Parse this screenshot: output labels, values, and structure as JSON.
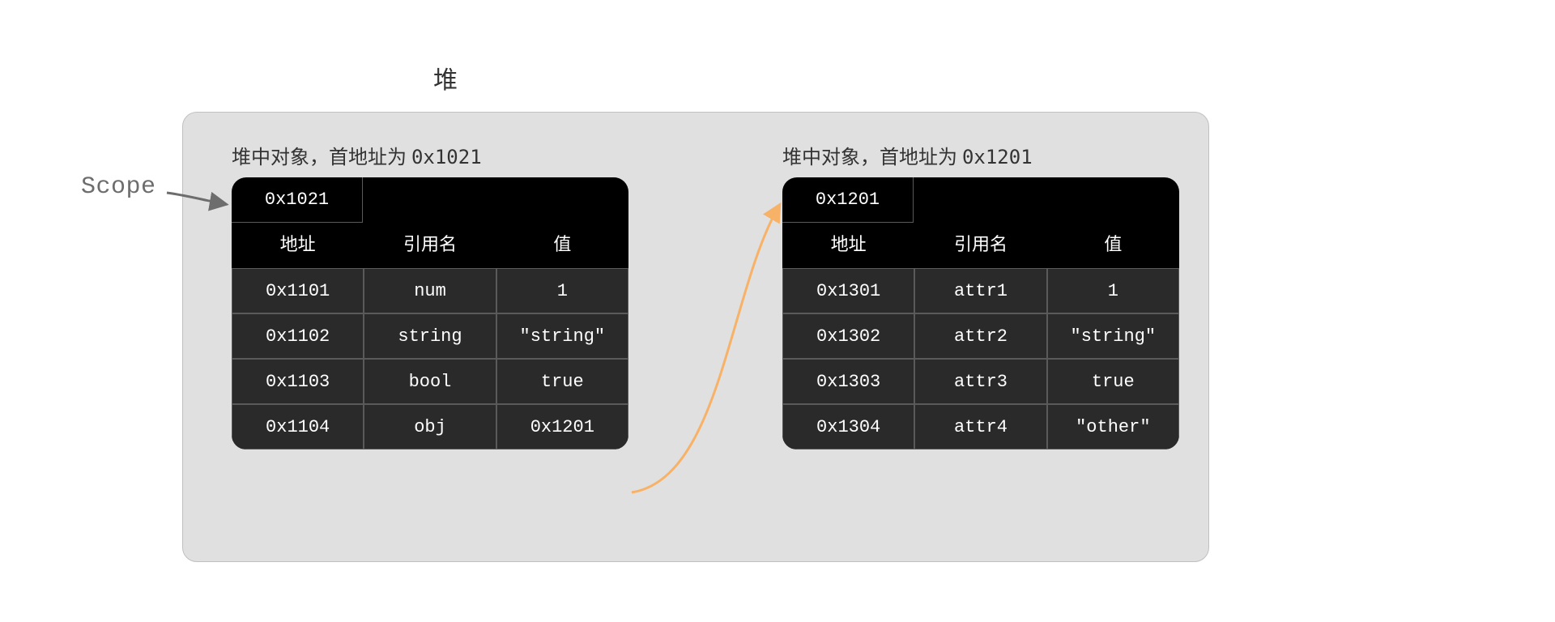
{
  "heap_title": "堆",
  "scope_label": "Scope",
  "objects": [
    {
      "caption_prefix": "堆中对象，首地址为 ",
      "caption_addr": "0x1021",
      "base_addr": "0x1021",
      "columns": {
        "address": "地址",
        "ref_name": "引用名",
        "value": "值"
      },
      "rows": [
        {
          "address": "0x1101",
          "ref": "num",
          "value": "1"
        },
        {
          "address": "0x1102",
          "ref": "string",
          "value": "\"string\""
        },
        {
          "address": "0x1103",
          "ref": "bool",
          "value": "true"
        },
        {
          "address": "0x1104",
          "ref": "obj",
          "value": "0x1201"
        }
      ]
    },
    {
      "caption_prefix": "堆中对象，首地址为 ",
      "caption_addr": "0x1201",
      "base_addr": "0x1201",
      "columns": {
        "address": "地址",
        "ref_name": "引用名",
        "value": "值"
      },
      "rows": [
        {
          "address": "0x1301",
          "ref": "attr1",
          "value": "1"
        },
        {
          "address": "0x1302",
          "ref": "attr2",
          "value": "\"string\""
        },
        {
          "address": "0x1303",
          "ref": "attr3",
          "value": "true"
        },
        {
          "address": "0x1304",
          "ref": "attr4",
          "value": "\"other\""
        }
      ]
    }
  ]
}
